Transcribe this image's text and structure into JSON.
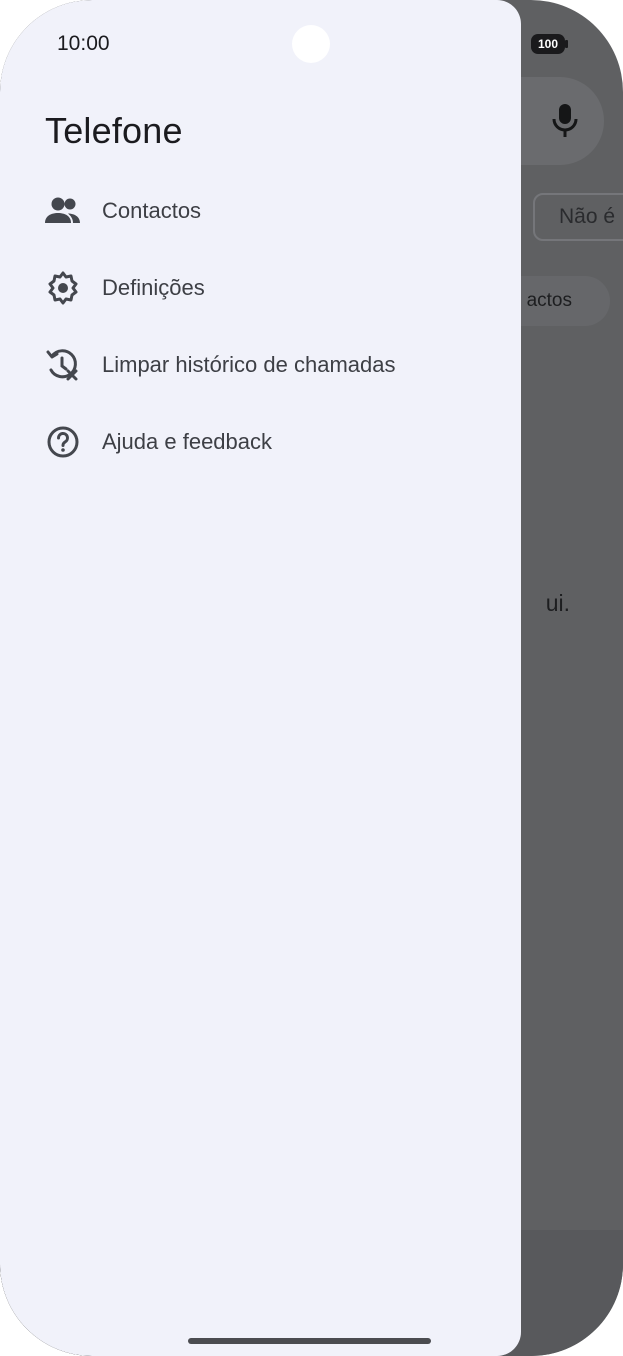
{
  "status_bar": {
    "time": "10:00",
    "battery_level": "100",
    "icons": [
      "signal-icon",
      "battery-icon"
    ]
  },
  "drawer": {
    "title": "Telefone",
    "items": [
      {
        "label": "Contactos",
        "icon": "contacts-icon"
      },
      {
        "label": "Definições",
        "icon": "gear-icon"
      },
      {
        "label": "Limpar histórico de chamadas",
        "icon": "clear-history-icon"
      },
      {
        "label": "Ajuda e feedback",
        "icon": "help-icon"
      }
    ]
  },
  "background_app": {
    "chip_label": "Não é",
    "pill_label": "actos",
    "body_text_fragment": "ui.",
    "icons": [
      "mic-icon"
    ]
  },
  "colors": {
    "drawer_background": "#f1f2fa",
    "scrim": "#5f6062",
    "text_primary": "#1b1b1f",
    "icon_color": "#44474e"
  }
}
